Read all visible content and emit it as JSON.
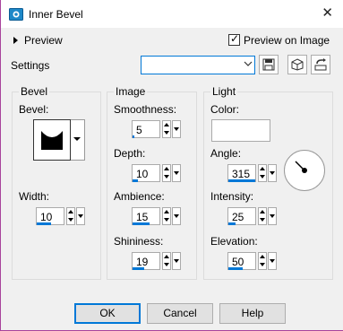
{
  "window": {
    "title": "Inner Bevel",
    "close_glyph": "✕"
  },
  "preview": {
    "label": "Preview",
    "preview_on_image_label": "Preview on Image",
    "preview_on_image_checked": true
  },
  "settings": {
    "label": "Settings",
    "selected": ""
  },
  "toolbar": {
    "icons": [
      "save-preset-icon",
      "load-preset-icon",
      "reset-icon"
    ]
  },
  "bevel_group": {
    "title": "Bevel",
    "bevel_label": "Bevel:",
    "width_label": "Width:",
    "width_value": "10"
  },
  "image_group": {
    "title": "Image",
    "smoothness_label": "Smoothness:",
    "smoothness_value": "5",
    "depth_label": "Depth:",
    "depth_value": "10",
    "ambience_label": "Ambience:",
    "ambience_value": "15",
    "shininess_label": "Shininess:",
    "shininess_value": "19"
  },
  "light_group": {
    "title": "Light",
    "color_label": "Color:",
    "color_value": "#ffffff",
    "angle_label": "Angle:",
    "angle_value": "315",
    "intensity_label": "Intensity:",
    "intensity_value": "25",
    "elevation_label": "Elevation:",
    "elevation_value": "50"
  },
  "buttons": {
    "ok": "OK",
    "cancel": "Cancel",
    "help": "Help"
  },
  "colors": {
    "accent": "#0078d7",
    "window_border": "#a8439c"
  }
}
